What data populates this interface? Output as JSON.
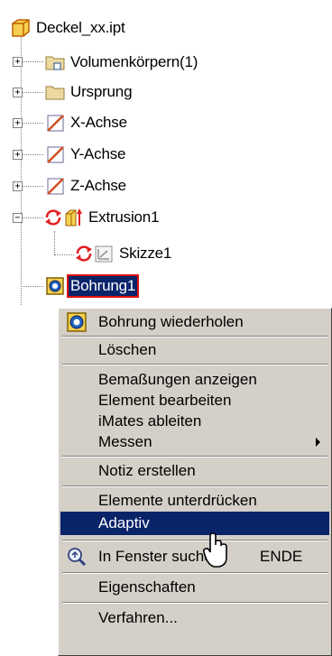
{
  "browser": {
    "root": "Deckel_xx.ipt",
    "items": [
      {
        "label": "Volumenkörpern(1)"
      },
      {
        "label": "Ursprung"
      },
      {
        "label": "X-Achse"
      },
      {
        "label": "Y-Achse"
      },
      {
        "label": "Z-Achse"
      },
      {
        "label": "Extrusion1"
      },
      {
        "label": "Skizze1"
      },
      {
        "label": "Bohrung1"
      }
    ]
  },
  "menu": {
    "items": [
      {
        "label": "Bohrung wiederholen"
      },
      {
        "label": "Löschen"
      },
      {
        "label": "Bemaßungen anzeigen"
      },
      {
        "label": "Element bearbeiten"
      },
      {
        "label": "iMates ableiten"
      },
      {
        "label": "Messen"
      },
      {
        "label": "Notiz erstellen"
      },
      {
        "label": "Elemente unterdrücken"
      },
      {
        "label": "Adaptiv"
      },
      {
        "label": "In Fenster suchen",
        "shortcut": "ENDE"
      },
      {
        "label": "Eigenschaften"
      },
      {
        "label": "Verfahren..."
      }
    ]
  },
  "colors": {
    "highlight": "#0a246a",
    "menu_bg": "#d4d0c8",
    "selection_outline": "#e01010"
  }
}
